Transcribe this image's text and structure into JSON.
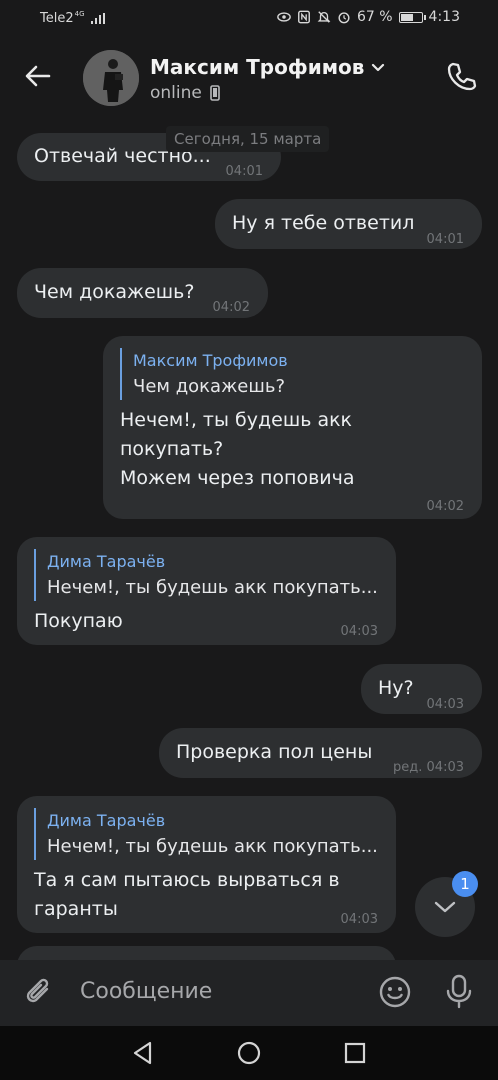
{
  "status_bar": {
    "carrier": "Tele2",
    "network": "4G",
    "battery": "67 %",
    "battery_level": 0.67,
    "time": "4:13"
  },
  "header": {
    "contact_name": "Максим Трофимов",
    "status": "online"
  },
  "chat": {
    "date_separator": "Сегодня, 15 марта",
    "messages": [
      {
        "direction": "in",
        "text": "Отвечай честно...",
        "time": "04:01"
      },
      {
        "direction": "out",
        "text": "Ну я тебе ответил",
        "time": "04:01"
      },
      {
        "direction": "in",
        "text": "Чем докажешь?",
        "time": "04:02"
      },
      {
        "direction": "out",
        "reply_author": "Максим Трофимов",
        "reply_text": "Чем докажешь?",
        "text_lines": [
          "Нечем!, ты будешь акк",
          "покупать?",
          "Можем через поповича"
        ],
        "time": "04:02"
      },
      {
        "direction": "in",
        "reply_author": "Дима Тарачёв",
        "reply_text": "Нечем!, ты будешь акк покупать...",
        "text": "Покупаю",
        "time": "04:03"
      },
      {
        "direction": "out",
        "text": "Ну?",
        "time": "04:03"
      },
      {
        "direction": "out",
        "text": "Проверка пол цены",
        "time": "ред. 04:03"
      },
      {
        "direction": "in",
        "reply_author": "Дима Тарачёв",
        "reply_text": "Нечем!, ты будешь акк покупать...",
        "text_lines": [
          "Та я сам пытаюсь вырваться в",
          "гаранты"
        ],
        "time": "04:03"
      }
    ]
  },
  "scroll_down": {
    "unread_count": "1"
  },
  "composer": {
    "placeholder": "Сообщение"
  },
  "icons": [
    "back-arrow-icon",
    "chevron-down-icon",
    "phone-icon",
    "call-icon",
    "paperclip-icon",
    "emoji-icon",
    "microphone-icon",
    "chevron-down-icon",
    "nav-back-icon",
    "nav-home-icon",
    "nav-recents-icon"
  ],
  "colors": {
    "background": "#19191a",
    "bubble": "#2d2f31",
    "reply_accent": "#7cb1f0",
    "badge": "#4a8ef0"
  }
}
